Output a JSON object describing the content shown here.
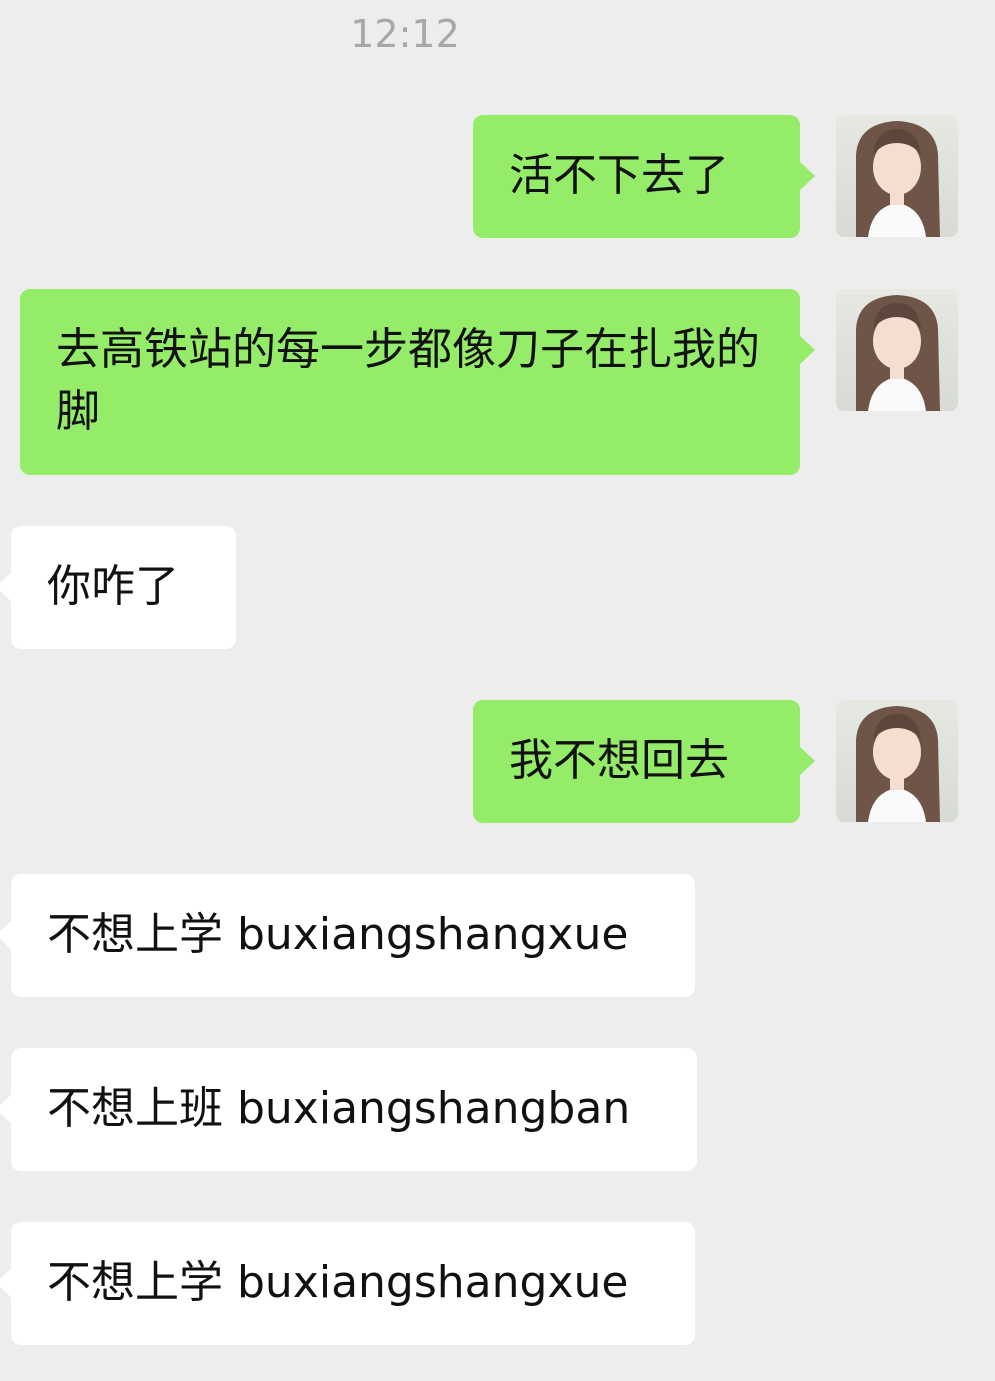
{
  "chat": {
    "timestamp": "12:12",
    "messages": [
      {
        "side": "out",
        "text": "活不下去了"
      },
      {
        "side": "out",
        "text": "去高铁站的每一步都像刀子在扎我的脚"
      },
      {
        "side": "in",
        "text": "你咋了"
      },
      {
        "side": "out",
        "text": "我不想回去"
      },
      {
        "side": "in",
        "text": "不想上学 buxiangshangxue"
      },
      {
        "side": "in",
        "text": "不想上班 buxiangshangban"
      },
      {
        "side": "in",
        "text": "不想上学 buxiangshangxue"
      }
    ]
  },
  "colors": {
    "background": "#ededed",
    "outgoing_bubble": "#95ec69",
    "incoming_bubble": "#ffffff",
    "timestamp_text": "#a8a8a8"
  },
  "icons": {
    "avatar": "user-avatar-photo"
  }
}
